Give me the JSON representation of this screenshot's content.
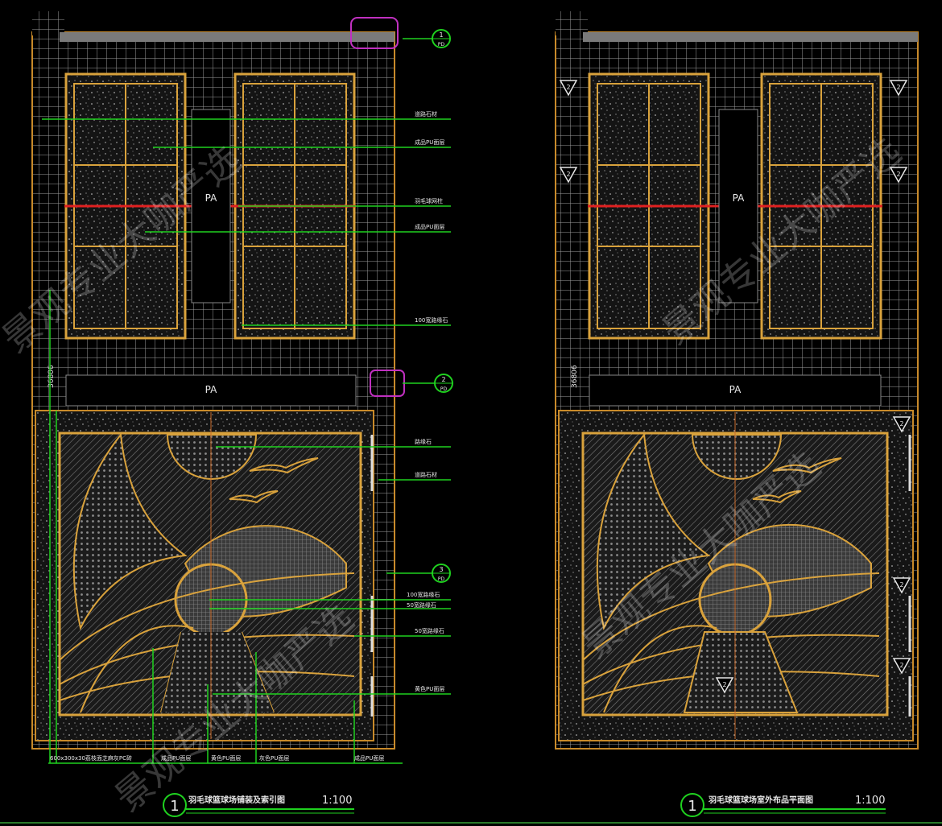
{
  "colors": {
    "background": "#000000",
    "grid_line": "#b8b8b8",
    "outline": "#c88a2a",
    "pattern": "#d9a23c",
    "leader": "#1fd11f",
    "red_line": "#e02020",
    "magenta": "#c030c0",
    "text": "#e8e8e8",
    "watermark": "#ffffff"
  },
  "left_plan": {
    "court_label_upper": "PA",
    "court_label_lower": "PA",
    "dimension_text": "36806",
    "index_markers": [
      {
        "number": "1",
        "sheet": "PD"
      },
      {
        "number": "2",
        "sheet": "PD"
      },
      {
        "number": "3",
        "sheet": "PD"
      }
    ],
    "right_callouts": [
      "道路石材",
      "成品PU面层",
      "羽毛球网柱",
      "成品PU面层",
      "100宽路缘石",
      "路缘石",
      "道路石材",
      "100宽路缘石",
      "50宽路缘石",
      "50宽路缘石",
      "黄色PU面层"
    ],
    "bottom_labels": [
      "600x300x30荔枝面芝麻灰PC砖",
      "成品PU面层",
      "黄色PU面层",
      "灰色PU面层",
      "成品PU面层"
    ],
    "title": "羽毛球篮球场铺装及索引图",
    "title_number": "1",
    "scale": "1:100"
  },
  "right_plan": {
    "court_label_upper": "PA",
    "court_label_lower": "PA",
    "dimension_text": "36806",
    "symbol_number": "2",
    "title": "羽毛球篮球场室外布品平面图",
    "title_number": "1",
    "scale": "1:100"
  },
  "watermark": {
    "text_a": "景观专业大咖严选",
    "text_b": "景观专业大咖严选"
  }
}
